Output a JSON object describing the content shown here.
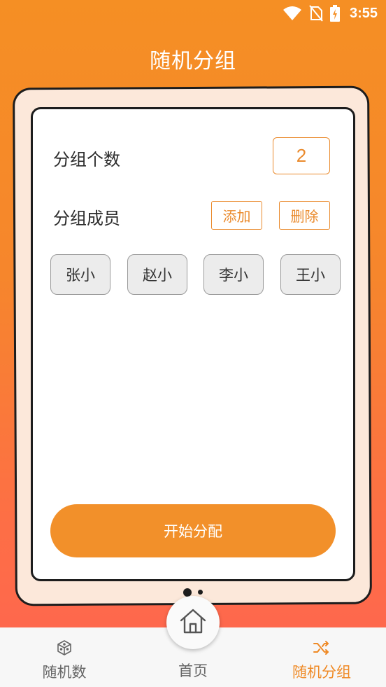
{
  "status_bar": {
    "time": "3:55",
    "icons": [
      "wifi-icon",
      "no-sim-icon",
      "battery-charging-icon"
    ]
  },
  "header": {
    "title": "随机分组"
  },
  "form": {
    "group_count_label": "分组个数",
    "group_count_value": "2",
    "members_label": "分组成员",
    "add_button": "添加",
    "delete_button": "删除",
    "members": [
      "张小",
      "赵小",
      "李小",
      "王小"
    ]
  },
  "start_button": "开始分配",
  "bottom_nav": {
    "items": [
      {
        "label": "随机数",
        "icon": "cube-icon",
        "active": false
      },
      {
        "label": "首页",
        "icon": "home-icon",
        "active": false
      },
      {
        "label": "随机分组",
        "icon": "shuffle-icon",
        "active": true
      }
    ]
  },
  "colors": {
    "accent": "#ef8a26",
    "gradient_top": "#f58f24",
    "gradient_bottom": "#ff6451",
    "frame_fill": "#fce8da",
    "chip_fill": "#ececec"
  }
}
